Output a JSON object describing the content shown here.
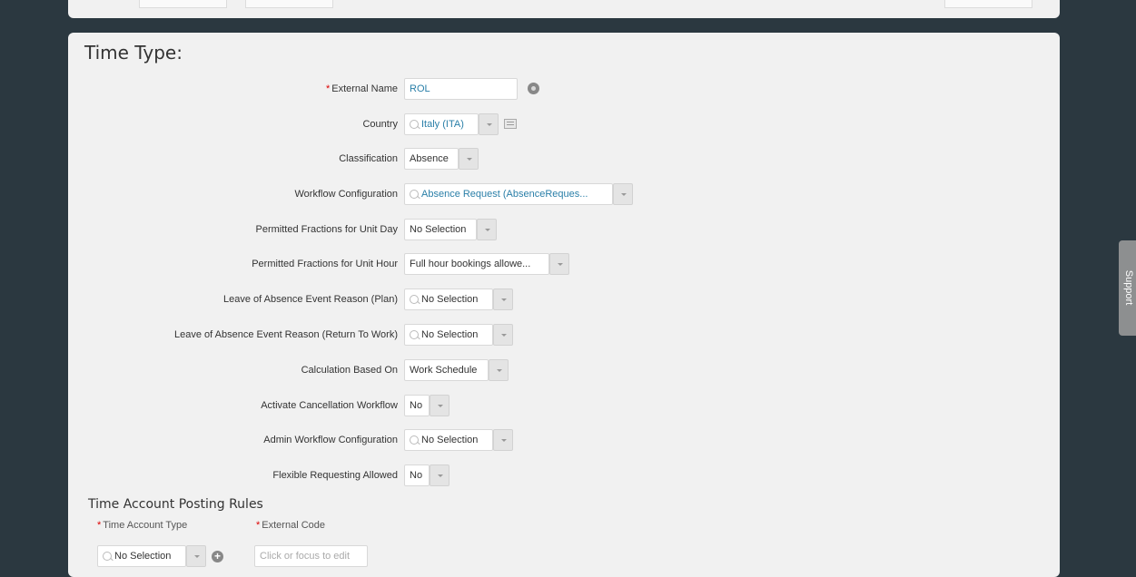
{
  "panel_title": "Time Type:",
  "fields": [
    {
      "label": "External Name",
      "required": true,
      "value": "ROL",
      "control": "text"
    },
    {
      "label": "Country",
      "value": "Italy (ITA)",
      "control": "lookup"
    },
    {
      "label": "Classification",
      "value": "Absence",
      "control": "select"
    },
    {
      "label": "Workflow Configuration",
      "value": "Absence Request (AbsenceReques...",
      "control": "lookup"
    },
    {
      "label": "Permitted Fractions for Unit Day",
      "value": "No Selection",
      "control": "select"
    },
    {
      "label": "Permitted Fractions for Unit Hour",
      "value": "Full hour bookings allowe...",
      "control": "select"
    },
    {
      "label": "Leave of Absence Event Reason (Plan)",
      "value": "No Selection",
      "control": "lookup"
    },
    {
      "label": "Leave of Absence Event Reason (Return To Work)",
      "value": "No Selection",
      "control": "lookup"
    },
    {
      "label": "Calculation Based On",
      "value": "Work Schedule",
      "control": "select"
    },
    {
      "label": "Activate Cancellation Workflow",
      "value": "No",
      "control": "select"
    },
    {
      "label": "Admin Workflow Configuration",
      "value": "No Selection",
      "control": "lookup"
    },
    {
      "label": "Flexible Requesting Allowed",
      "value": "No",
      "control": "select"
    }
  ],
  "posting_rules": {
    "title": "Time Account Posting Rules",
    "col_time_account_type": "Time Account Type",
    "col_external_code": "External Code",
    "time_account_type_value": "No Selection",
    "external_code_placeholder": "Click or focus to edit"
  },
  "support_tab": "Support",
  "colors": {
    "background": "#2b3840",
    "panel": "#f1f1f1",
    "link": "#2a7fa8",
    "required": "#dd0000"
  }
}
